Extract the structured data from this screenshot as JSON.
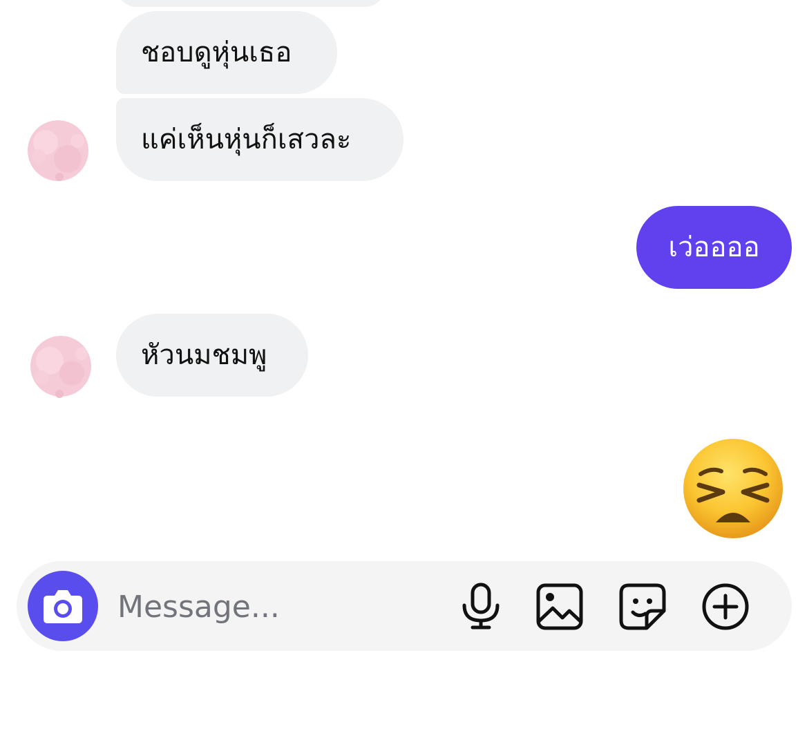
{
  "conversation": {
    "messages": [
      {
        "sender": "them",
        "text": ""
      },
      {
        "sender": "them",
        "text": "ชอบดูหุ่นเธอ"
      },
      {
        "sender": "them",
        "text": "แค่เห็นหุ่นก็เสวละ"
      },
      {
        "sender": "me",
        "text": "เว่ออออ"
      },
      {
        "sender": "them",
        "text": "หัวนมชมพู"
      },
      {
        "sender": "me",
        "emoji": "persevering-face-emoji"
      }
    ]
  },
  "composer": {
    "placeholder": "Message...",
    "icons": [
      "camera-icon",
      "microphone-icon",
      "gallery-icon",
      "sticker-icon",
      "add-circle-icon"
    ]
  },
  "colors": {
    "incoming_bubble": "#eff1f2",
    "outgoing_bubble": "#6141ee",
    "camera_button": "#5a4dee",
    "composer_background": "#f4f4f5",
    "avatar_blur": "#f6cbd8"
  }
}
